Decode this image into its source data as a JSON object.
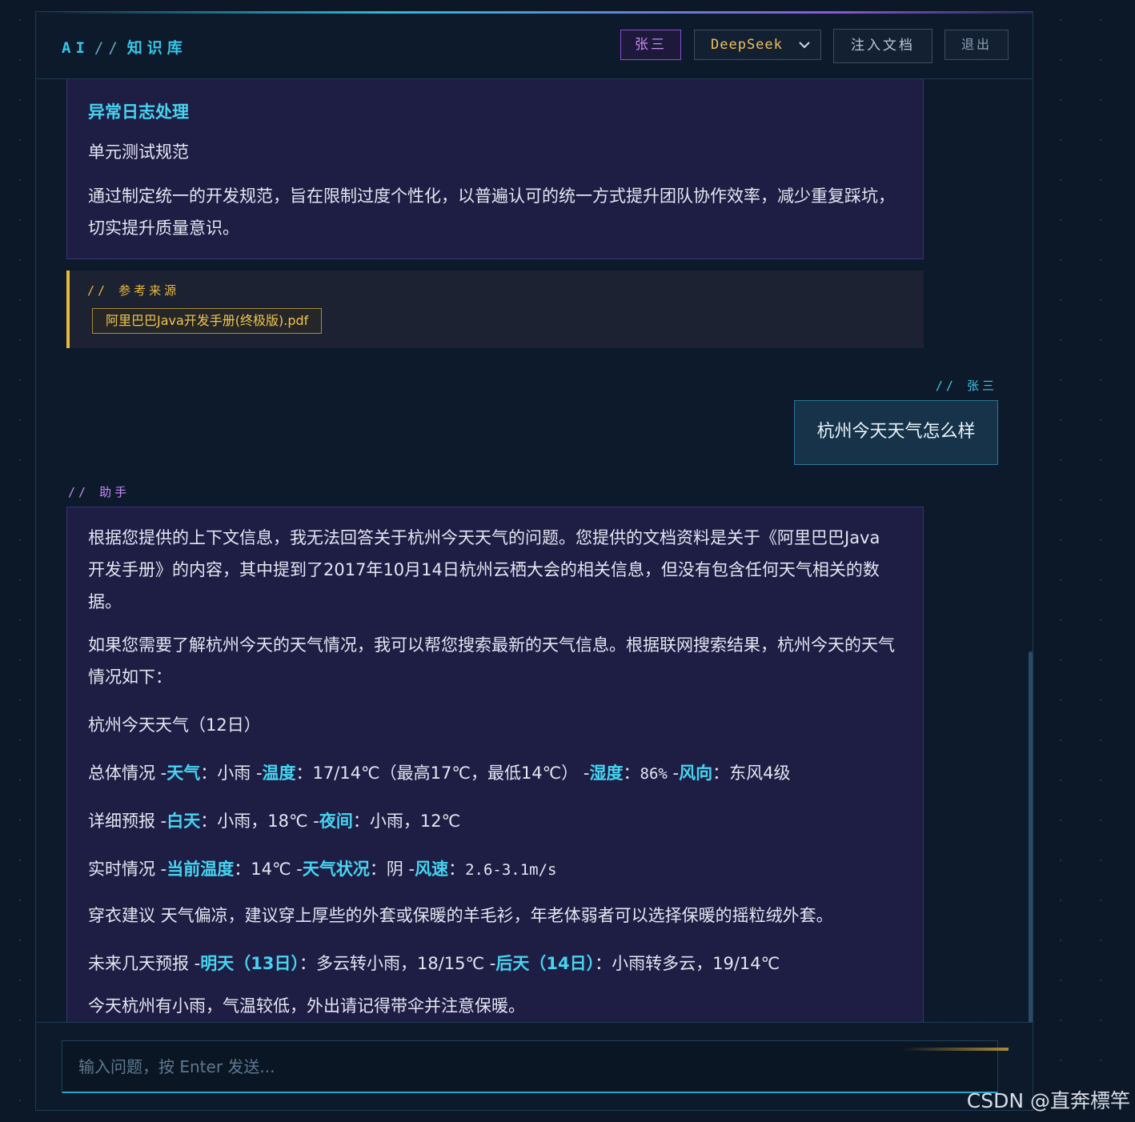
{
  "header": {
    "brand_prefix": "AI",
    "brand_sep": "//",
    "brand_title": "知识库",
    "user_name": "张三",
    "model": "DeepSeek",
    "inject_label": "注入文档",
    "logout_label": "退出"
  },
  "messages": {
    "ai_prev": {
      "title": "异常日志处理",
      "subtitle": "单元测试规范",
      "paragraph": "通过制定统一的开发规范，旨在限制过度个性化，以普遍认可的统一方式提升团队协作效率，减少重复踩坑，切实提升质量意识。"
    },
    "references": {
      "label": "// 参考来源",
      "file": "阿里巴巴Java开发手册(终极版).pdf"
    },
    "user": {
      "role": "// 张三",
      "text": "杭州今天天气怎么样"
    },
    "ai": {
      "role": "// 助手",
      "p1": "根据您提供的上下文信息，我无法回答关于杭州今天天气的问题。您提供的文档资料是关于《阿里巴巴Java 开发手册》的内容，其中提到了2017年10月14日杭州云栖大会的相关信息，但没有包含任何天气相关的数据。",
      "p2": "如果您需要了解杭州今天的天气情况，我可以帮您搜索最新的天气信息。根据联网搜索结果，杭州今天的天气情况如下：",
      "p3": "杭州今天天气（12日）",
      "overall": {
        "label": "总体情况",
        "k1": "天气",
        "v1": "小雨",
        "k2": "温度",
        "v2": "17/14℃（最高17℃，最低14℃）",
        "k3": "湿度",
        "v3": "86%",
        "k4": "风向",
        "v4": "东风4级"
      },
      "detail": {
        "label": "详细预报",
        "k1": "白天",
        "v1": "小雨，18℃",
        "k2": "夜间",
        "v2": "小雨，12℃"
      },
      "realtime": {
        "label": "实时情况",
        "k1": "当前温度",
        "v1": "14℃",
        "k2": "天气状况",
        "v2": "阴",
        "k3": "风速",
        "v3": "2.6-3.1m/s"
      },
      "clothing": {
        "label": "穿衣建议",
        "text": "天气偏凉，建议穿上厚些的外套或保暖的羊毛衫，年老体弱者可以选择保暖的摇粒绒外套。"
      },
      "future": {
        "label": "未来几天预报",
        "k1": "明天（13日）",
        "v1": "多云转小雨，18/15℃",
        "k2": "后天（14日）",
        "v2": "小雨转多云，19/14℃"
      },
      "closing": "今天杭州有小雨，气温较低，外出请记得带伞并注意保暖。"
    }
  },
  "input": {
    "placeholder": "输入问题，按 Enter 发送..."
  },
  "watermark": "CSDN @直奔標竿",
  "colors": {
    "accent_cyan": "#46d4f0",
    "accent_purple": "#c98cf5",
    "accent_gold": "#e9b93a"
  }
}
